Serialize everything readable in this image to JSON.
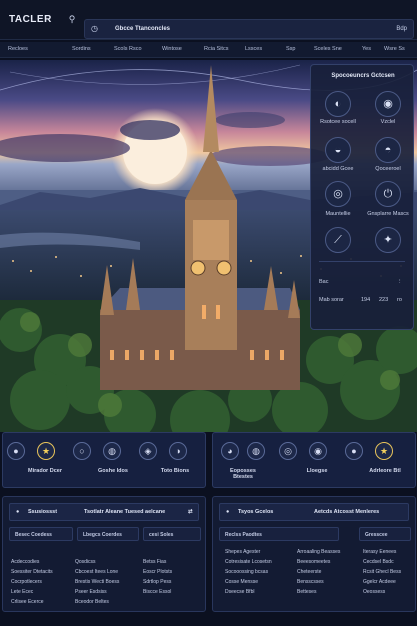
{
  "topbar": {
    "logo": "TACLER",
    "search_text": "Gbcce Ttanconcles",
    "search_button": "Bdp"
  },
  "nav": [
    "Recloes",
    "Sordins",
    "Scols Rsco",
    "Wintose",
    "Rcia Sitcs",
    "Lssces",
    "Ssp",
    "Sceles Sne",
    "Yes",
    "Wsre Ss"
  ],
  "right_panel": {
    "title": "Spocoeuncrs Gctcsen",
    "items": [
      {
        "label": "Rsotcee socell",
        "icon": "moon-icon"
      },
      {
        "label": "Vzclel",
        "icon": "globe-icon"
      },
      {
        "label": "abcidd Gcee",
        "icon": "landscape-icon"
      },
      {
        "label": "Qoceeroel",
        "icon": "night-icon"
      },
      {
        "label": "Mauntellie",
        "icon": "compass-icon"
      },
      {
        "label": "Gnsplarre Mascs",
        "icon": "power-icon"
      },
      {
        "label": "Tetonccre",
        "icon": "wand-icon"
      },
      {
        "label": "Gleccsers",
        "icon": "stars-icon"
      }
    ],
    "footer_left": "Bac",
    "footer_stats": [
      "Mab sorar",
      "194",
      "223",
      "ro"
    ]
  },
  "left_cards": [
    {
      "label": "Mirador Dcer",
      "icon": "record-icon"
    },
    {
      "label": "",
      "icon": "star-icon"
    },
    {
      "label": "Goshe Idos",
      "icon": "circle-icon"
    },
    {
      "label": "",
      "icon": "disc-icon"
    },
    {
      "label": "Toto Bions",
      "icon": "target-icon"
    }
  ],
  "right_cards": [
    {
      "label": "Eoposses Btestes",
      "icon": "planet-icon"
    },
    {
      "label": "",
      "icon": "orb-icon"
    },
    {
      "label": "Lloegse",
      "icon": "radio-icon"
    },
    {
      "label": "",
      "icon": "earth-icon"
    },
    {
      "label": "Adrleore Btl",
      "icon": "star-icon"
    }
  ],
  "bottom_left": {
    "head_left": "Ssusiossst",
    "head_mid": "Tsotlatr Aleane Tuesed aelcane",
    "tabs": [
      "Besec Coedess",
      "Lbegcs Coerdes",
      "cesi Soles"
    ],
    "col1": [
      "Acdeccodies",
      "Soessiter Dtetacits",
      "Cocrpotlecers",
      "Lete Ecec",
      "Crlisee Ecerce"
    ],
    "col2": [
      "Qosdicss",
      "Cbcoest Itees Lone",
      "Brestis Wecti Boess",
      "Pseer Esdsiss",
      "Bceodor Beltes"
    ],
    "col3": [
      "Betss Fias",
      "Eoscr Plotsts",
      "Sdrtlop Pess",
      "Biscce Essol"
    ]
  },
  "bottom_right": {
    "head_left": "Tsyos Gcelos",
    "head_mid": "Aetcds Atcosst Menleres",
    "tabs": [
      "Reclss Paodtes",
      "Gresscee"
    ],
    "col1": [
      "Shepes Agester",
      "Cotresisate Lcosetsn",
      "Socooossing bcsas",
      "Cosse Mensse",
      "Dseecse Bfbl"
    ],
    "col2": [
      "Arroaaling Beasses",
      "Beeesomeetes",
      "Cheteerste",
      "Bensscsses",
      "Betteses"
    ],
    "col3": [
      "Iterasy Eenees",
      "Cecdsel Bsdc",
      "Rcsit Ghecl Bess",
      "Ggelcr Acdeee",
      "Oeossess"
    ]
  }
}
